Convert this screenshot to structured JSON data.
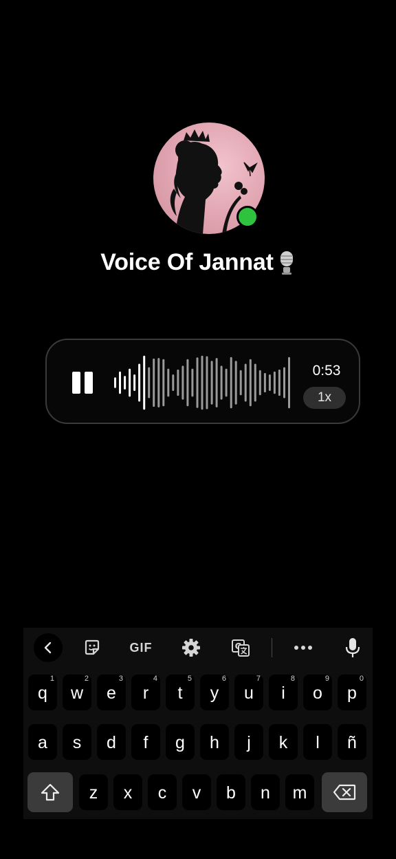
{
  "profile": {
    "name": "Voice Of Jannat",
    "online": true,
    "colors": {
      "online": "#2fc23e",
      "avatar_bg": "#e3a9b5"
    }
  },
  "voice_message": {
    "state": "playing",
    "duration": "0:53",
    "speed": "1x",
    "waveform": [
      0.15,
      0.35,
      0.2,
      0.45,
      0.25,
      0.62,
      0.9,
      0.5,
      0.8,
      0.82,
      0.78,
      0.45,
      0.25,
      0.42,
      0.55,
      0.78,
      0.45,
      0.84,
      0.9,
      0.88,
      0.72,
      0.82,
      0.55,
      0.45,
      0.85,
      0.72,
      0.4,
      0.62,
      0.78,
      0.62,
      0.4,
      0.3,
      0.25,
      0.35,
      0.42,
      0.5,
      0.85
    ]
  },
  "keyboard": {
    "toolbar": {
      "back_icon": "chevron-left-icon",
      "sticker_icon": "sticker-icon",
      "gif_label": "GIF",
      "settings_icon": "gear-icon",
      "translate_icon": "translate-icon",
      "more_icon": "more-icon",
      "mic_icon": "mic-icon"
    },
    "rows": [
      [
        {
          "c": "q",
          "h": "1"
        },
        {
          "c": "w",
          "h": "2"
        },
        {
          "c": "e",
          "h": "3"
        },
        {
          "c": "r",
          "h": "4"
        },
        {
          "c": "t",
          "h": "5"
        },
        {
          "c": "y",
          "h": "6"
        },
        {
          "c": "u",
          "h": "7"
        },
        {
          "c": "i",
          "h": "8"
        },
        {
          "c": "o",
          "h": "9"
        },
        {
          "c": "p",
          "h": "0"
        }
      ],
      [
        {
          "c": "a",
          "h": ""
        },
        {
          "c": "s",
          "h": ""
        },
        {
          "c": "d",
          "h": ""
        },
        {
          "c": "f",
          "h": ""
        },
        {
          "c": "g",
          "h": ""
        },
        {
          "c": "h",
          "h": ""
        },
        {
          "c": "j",
          "h": ""
        },
        {
          "c": "k",
          "h": ""
        },
        {
          "c": "l",
          "h": ""
        },
        {
          "c": "ñ",
          "h": ""
        }
      ],
      [
        {
          "c": "z",
          "h": ""
        },
        {
          "c": "x",
          "h": ""
        },
        {
          "c": "c",
          "h": ""
        },
        {
          "c": "v",
          "h": ""
        },
        {
          "c": "b",
          "h": ""
        },
        {
          "c": "n",
          "h": ""
        },
        {
          "c": "m",
          "h": ""
        }
      ]
    ],
    "shift_icon": "shift-icon",
    "backspace_icon": "backspace-icon"
  }
}
